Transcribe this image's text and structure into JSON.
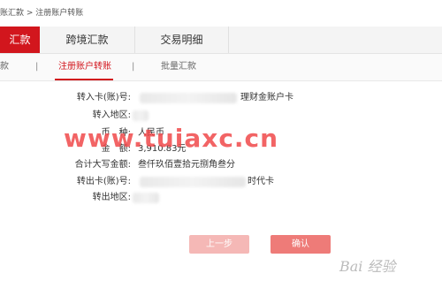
{
  "breadcrumb": "账汇款 > 注册账户转账",
  "tabs": [
    {
      "label": "汇款"
    },
    {
      "label": "跨境汇款"
    },
    {
      "label": "交易明细"
    }
  ],
  "subnav": {
    "item1": "款",
    "separator": "|",
    "item2": "注册账户转账",
    "item3": "批量汇款"
  },
  "form": {
    "to_card_label": "转入卡(账)号:",
    "to_card_suffix": "理财金账户卡",
    "to_region_label": "转入地区:",
    "currency_label": "币　种:",
    "currency_value": "人民币",
    "amount_label": "金　额:",
    "amount_value": "3,910.83元",
    "amount_upper_label": "合计大写金额:",
    "amount_upper_value": "叁仟玖佰壹拾元捌角叁分",
    "from_card_label": "转出卡(账)号:",
    "from_card_suffix": "时代卡",
    "from_region_label": "转出地区:"
  },
  "buttons": {
    "prev": "上一步",
    "confirm": "确认"
  },
  "watermark": "www.tuiaxc.cn",
  "logo_watermark": "Bai 经验"
}
